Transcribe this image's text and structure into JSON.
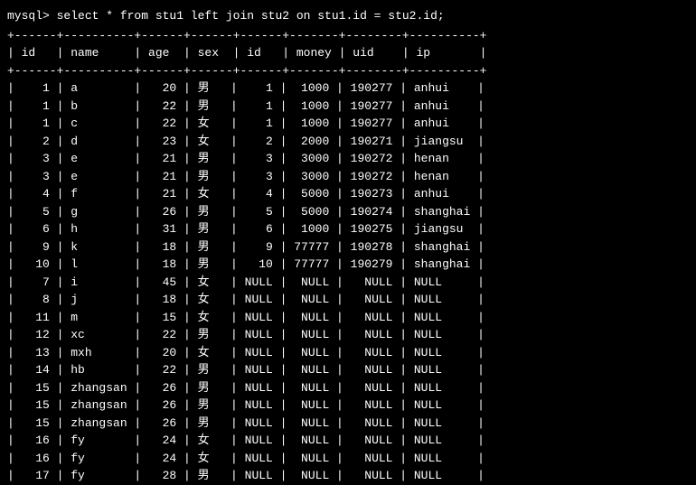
{
  "prompt": "mysql> ",
  "query": "select * from stu1 left join stu2 on stu1.id = stu2.id;",
  "separator": "+------+----------+------+------+------+-------+--------+----------+",
  "headers": [
    "id",
    "name",
    "age",
    "sex",
    "id",
    "money",
    "uid",
    "ip"
  ],
  "rows": [
    {
      "id1": "1",
      "name": "a",
      "age": "20",
      "sex": "男",
      "id2": "1",
      "money": "1000",
      "uid": "190277",
      "ip": "anhui"
    },
    {
      "id1": "1",
      "name": "b",
      "age": "22",
      "sex": "男",
      "id2": "1",
      "money": "1000",
      "uid": "190277",
      "ip": "anhui"
    },
    {
      "id1": "1",
      "name": "c",
      "age": "22",
      "sex": "女",
      "id2": "1",
      "money": "1000",
      "uid": "190277",
      "ip": "anhui"
    },
    {
      "id1": "2",
      "name": "d",
      "age": "23",
      "sex": "女",
      "id2": "2",
      "money": "2000",
      "uid": "190271",
      "ip": "jiangsu"
    },
    {
      "id1": "3",
      "name": "e",
      "age": "21",
      "sex": "男",
      "id2": "3",
      "money": "3000",
      "uid": "190272",
      "ip": "henan"
    },
    {
      "id1": "3",
      "name": "e",
      "age": "21",
      "sex": "男",
      "id2": "3",
      "money": "3000",
      "uid": "190272",
      "ip": "henan"
    },
    {
      "id1": "4",
      "name": "f",
      "age": "21",
      "sex": "女",
      "id2": "4",
      "money": "5000",
      "uid": "190273",
      "ip": "anhui"
    },
    {
      "id1": "5",
      "name": "g",
      "age": "26",
      "sex": "男",
      "id2": "5",
      "money": "5000",
      "uid": "190274",
      "ip": "shanghai"
    },
    {
      "id1": "6",
      "name": "h",
      "age": "31",
      "sex": "男",
      "id2": "6",
      "money": "1000",
      "uid": "190275",
      "ip": "jiangsu"
    },
    {
      "id1": "9",
      "name": "k",
      "age": "18",
      "sex": "男",
      "id2": "9",
      "money": "77777",
      "uid": "190278",
      "ip": "shanghai"
    },
    {
      "id1": "10",
      "name": "l",
      "age": "18",
      "sex": "男",
      "id2": "10",
      "money": "77777",
      "uid": "190279",
      "ip": "shanghai"
    },
    {
      "id1": "7",
      "name": "i",
      "age": "45",
      "sex": "女",
      "id2": "NULL",
      "money": "NULL",
      "uid": "NULL",
      "ip": "NULL"
    },
    {
      "id1": "8",
      "name": "j",
      "age": "18",
      "sex": "女",
      "id2": "NULL",
      "money": "NULL",
      "uid": "NULL",
      "ip": "NULL"
    },
    {
      "id1": "11",
      "name": "m",
      "age": "15",
      "sex": "女",
      "id2": "NULL",
      "money": "NULL",
      "uid": "NULL",
      "ip": "NULL"
    },
    {
      "id1": "12",
      "name": "xc",
      "age": "22",
      "sex": "男",
      "id2": "NULL",
      "money": "NULL",
      "uid": "NULL",
      "ip": "NULL"
    },
    {
      "id1": "13",
      "name": "mxh",
      "age": "20",
      "sex": "女",
      "id2": "NULL",
      "money": "NULL",
      "uid": "NULL",
      "ip": "NULL"
    },
    {
      "id1": "14",
      "name": "hb",
      "age": "22",
      "sex": "男",
      "id2": "NULL",
      "money": "NULL",
      "uid": "NULL",
      "ip": "NULL"
    },
    {
      "id1": "15",
      "name": "zhangsan",
      "age": "26",
      "sex": "男",
      "id2": "NULL",
      "money": "NULL",
      "uid": "NULL",
      "ip": "NULL"
    },
    {
      "id1": "15",
      "name": "zhangsan",
      "age": "26",
      "sex": "男",
      "id2": "NULL",
      "money": "NULL",
      "uid": "NULL",
      "ip": "NULL"
    },
    {
      "id1": "15",
      "name": "zhangsan",
      "age": "26",
      "sex": "男",
      "id2": "NULL",
      "money": "NULL",
      "uid": "NULL",
      "ip": "NULL"
    },
    {
      "id1": "16",
      "name": "fy",
      "age": "24",
      "sex": "女",
      "id2": "NULL",
      "money": "NULL",
      "uid": "NULL",
      "ip": "NULL"
    },
    {
      "id1": "16",
      "name": "fy",
      "age": "24",
      "sex": "女",
      "id2": "NULL",
      "money": "NULL",
      "uid": "NULL",
      "ip": "NULL"
    },
    {
      "id1": "17",
      "name": "fy",
      "age": "28",
      "sex": "男",
      "id2": "NULL",
      "money": "NULL",
      "uid": "NULL",
      "ip": "NULL"
    }
  ],
  "col_widths": {
    "id1": 4,
    "name": 8,
    "age": 4,
    "sex": 4,
    "id2": 4,
    "money": 5,
    "uid": 6,
    "ip": 8
  }
}
